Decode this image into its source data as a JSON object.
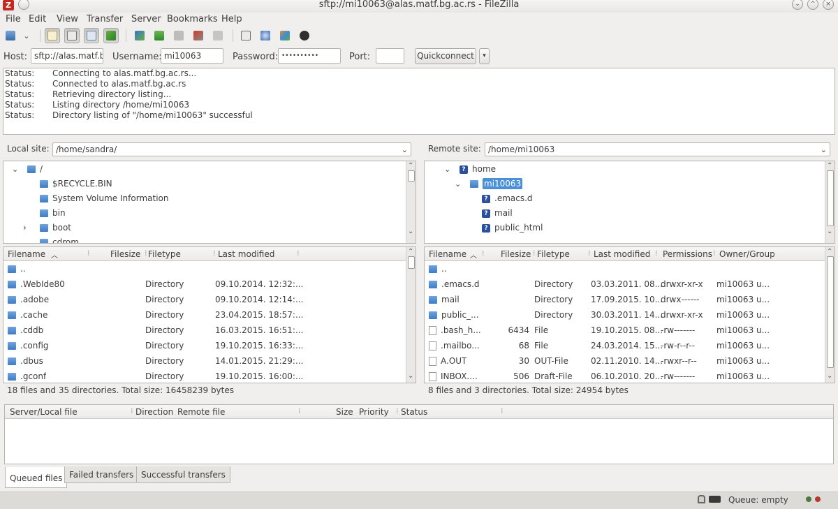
{
  "window": {
    "title": "sftp://mi10063@alas.matf.bg.ac.rs - FileZilla",
    "app_icon": "Z"
  },
  "menu": [
    "File",
    "Edit",
    "View",
    "Transfer",
    "Server",
    "Bookmarks",
    "Help"
  ],
  "quickconnect": {
    "host_label": "Host:",
    "host_value": "sftp://alas.matf.b",
    "username_label": "Username:",
    "username_value": "mi10063",
    "password_label": "Password:",
    "password_value": "••••••••••",
    "port_label": "Port:",
    "port_value": "",
    "button_label": "Quickconnect"
  },
  "log": [
    {
      "type": "Status:",
      "text": "Connecting to alas.matf.bg.ac.rs..."
    },
    {
      "type": "Status:",
      "text": "Connected to alas.matf.bg.ac.rs"
    },
    {
      "type": "Status:",
      "text": "Retrieving directory listing..."
    },
    {
      "type": "Status:",
      "text": "Listing directory /home/mi10063"
    },
    {
      "type": "Status:",
      "text": "Directory listing of \"/home/mi10063\" successful"
    }
  ],
  "local": {
    "site_label": "Local site:",
    "path": "/home/sandra/",
    "tree": [
      {
        "label": "/",
        "expander": "⌄"
      },
      {
        "label": "$RECYCLE.BIN",
        "expander": ""
      },
      {
        "label": "System Volume Information",
        "expander": ""
      },
      {
        "label": "bin",
        "expander": ""
      },
      {
        "label": "boot",
        "expander": "›"
      },
      {
        "label": "cdrom",
        "expander": ""
      }
    ],
    "columns": [
      "Filename",
      "Filesize",
      "Filetype",
      "Last modified"
    ],
    "files": [
      {
        "name": "..",
        "size": "",
        "type": "",
        "modified": ""
      },
      {
        "name": ".WebIde80",
        "size": "",
        "type": "Directory",
        "modified": "09.10.2014. 12:32:..."
      },
      {
        "name": ".adobe",
        "size": "",
        "type": "Directory",
        "modified": "09.10.2014. 12:14:..."
      },
      {
        "name": ".cache",
        "size": "",
        "type": "Directory",
        "modified": "23.04.2015. 18:57:..."
      },
      {
        "name": ".cddb",
        "size": "",
        "type": "Directory",
        "modified": "16.03.2015. 16:51:..."
      },
      {
        "name": ".config",
        "size": "",
        "type": "Directory",
        "modified": "19.10.2015. 16:33:..."
      },
      {
        "name": ".dbus",
        "size": "",
        "type": "Directory",
        "modified": "14.01.2015. 21:29:..."
      },
      {
        "name": ".gconf",
        "size": "",
        "type": "Directory",
        "modified": "19.10.2015. 16:00:..."
      }
    ],
    "summary": "18 files and 35 directories. Total size: 16458239 bytes"
  },
  "remote": {
    "site_label": "Remote site:",
    "path": "/home/mi10063",
    "tree": [
      {
        "label": "home",
        "expander": "⌄"
      },
      {
        "label": "mi10063",
        "expander": "⌄"
      },
      {
        "label": ".emacs.d",
        "expander": ""
      },
      {
        "label": "mail",
        "expander": ""
      },
      {
        "label": "public_html",
        "expander": ""
      }
    ],
    "columns": [
      "Filename",
      "Filesize",
      "Filetype",
      "Last modified",
      "Permissions",
      "Owner/Group"
    ],
    "files": [
      {
        "name": "..",
        "size": "",
        "type": "",
        "modified": "",
        "perms": "",
        "owner": ""
      },
      {
        "name": ".emacs.d",
        "size": "",
        "type": "Directory",
        "modified": "03.03.2011. 08...",
        "perms": "drwxr-xr-x",
        "owner": "mi10063 u..."
      },
      {
        "name": "mail",
        "size": "",
        "type": "Directory",
        "modified": "17.09.2015. 10...",
        "perms": "drwx------",
        "owner": "mi10063 u..."
      },
      {
        "name": "public_...",
        "size": "",
        "type": "Directory",
        "modified": "30.03.2011. 14...",
        "perms": "drwxr-xr-x",
        "owner": "mi10063 u..."
      },
      {
        "name": ".bash_h...",
        "size": "6434",
        "type": "File",
        "modified": "19.10.2015. 08...",
        "perms": "-rw-------",
        "owner": "mi10063 u..."
      },
      {
        "name": ".mailbo...",
        "size": "68",
        "type": "File",
        "modified": "24.03.2014. 15...",
        "perms": "-rw-r--r--",
        "owner": "mi10063 u..."
      },
      {
        "name": "A.OUT",
        "size": "30",
        "type": "OUT-File",
        "modified": "02.11.2010. 14...",
        "perms": "-rwxr--r--",
        "owner": "mi10063 u..."
      },
      {
        "name": "INBOX....",
        "size": "506",
        "type": "Draft-File",
        "modified": "06.10.2010. 20...",
        "perms": "-rw-------",
        "owner": "mi10063 u..."
      }
    ],
    "summary": "8 files and 3 directories. Total size: 24954 bytes"
  },
  "queue": {
    "columns": [
      "Server/Local file",
      "Direction",
      "Remote file",
      "Size",
      "Priority",
      "Status"
    ],
    "tabs": [
      "Queued files",
      "Failed transfers",
      "Successful transfers"
    ]
  },
  "statusbar": {
    "queue_text": "Queue: empty"
  },
  "colors": {
    "selection": "#4a90d9",
    "folder": "#3f7cc7",
    "brand": "#c32a1f"
  }
}
